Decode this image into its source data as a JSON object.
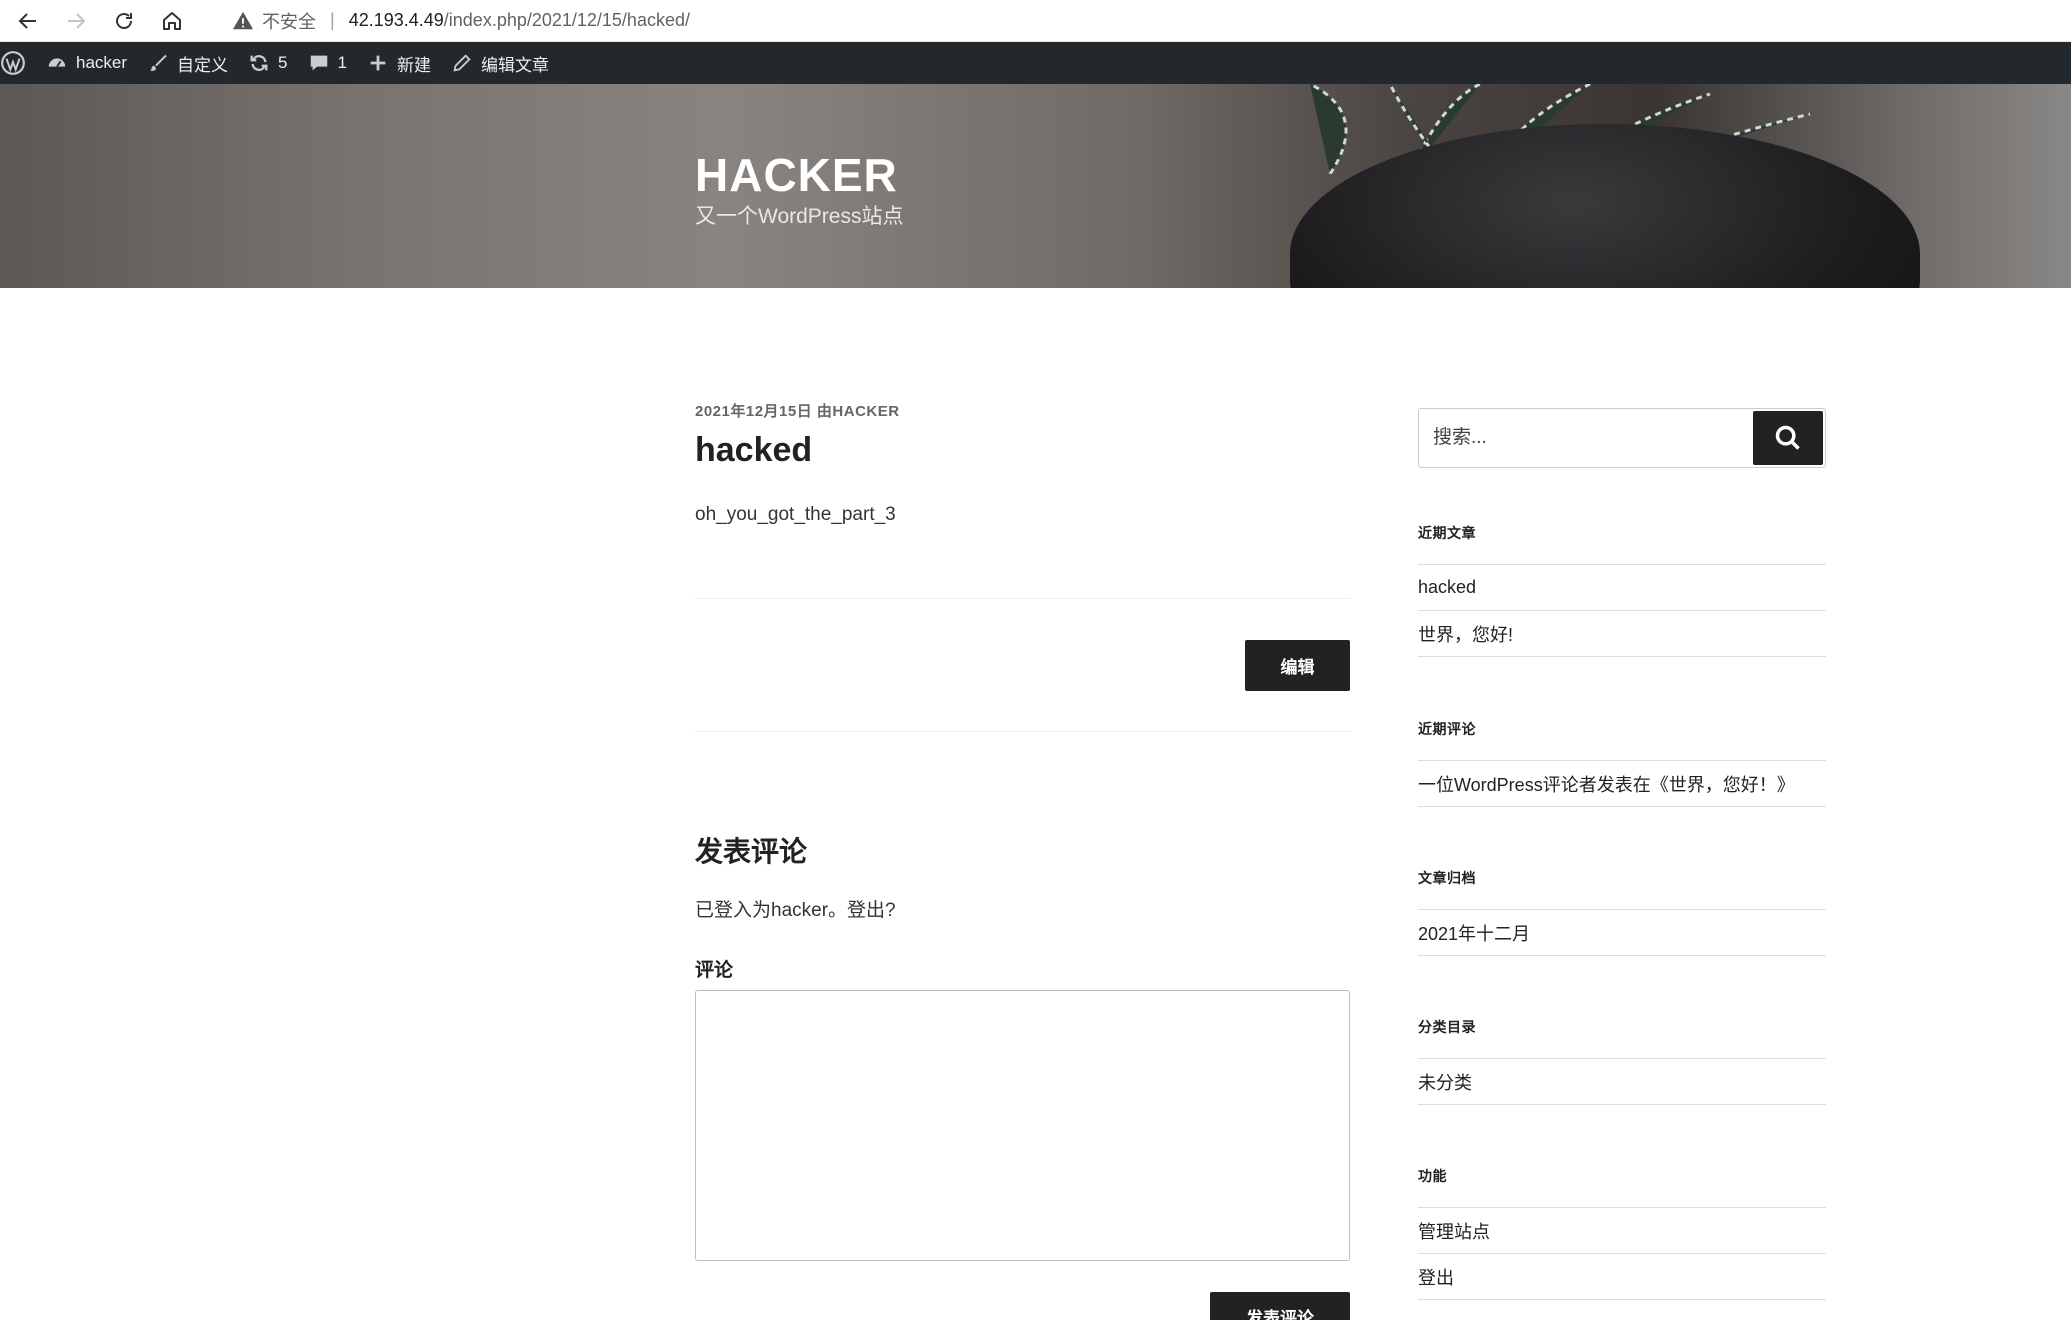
{
  "browser": {
    "insecure_label": "不安全",
    "separator": "|",
    "url_host": "42.193.4.49",
    "url_path": "/index.php/2021/12/15/hacked/"
  },
  "adminbar": {
    "site_name": "hacker",
    "customize": "自定义",
    "updates_count": "5",
    "comments_count": "1",
    "new": "新建",
    "edit_post": "编辑文章"
  },
  "header": {
    "title": "HACKER",
    "description": "又一个WordPress站点"
  },
  "post": {
    "meta": "2021年12月15日 由HACKER",
    "title": "hacked",
    "body": "oh_you_got_the_part_3",
    "edit_label": "编辑"
  },
  "comments": {
    "reply_title": "发表评论",
    "logged_in": "已登入为hacker。登出?",
    "comment_label": "评论",
    "comment_value": "",
    "submit_label": "发表评论"
  },
  "sidebar": {
    "search_placeholder": "搜索...",
    "widgets": [
      {
        "title": "近期文章",
        "items": [
          "hacked",
          "世界，您好!"
        ]
      },
      {
        "title": "近期评论",
        "items": [
          "一位WordPress评论者发表在《世界，您好！》"
        ]
      },
      {
        "title": "文章归档",
        "items": [
          "2021年十二月"
        ]
      },
      {
        "title": "分类目录",
        "items": [
          "未分类"
        ]
      },
      {
        "title": "功能",
        "items": [
          "管理站点",
          "登出"
        ]
      }
    ]
  },
  "colors": {
    "adminbar_bg": "#23282d",
    "button_bg": "#222222",
    "accent_text": "#222222"
  }
}
